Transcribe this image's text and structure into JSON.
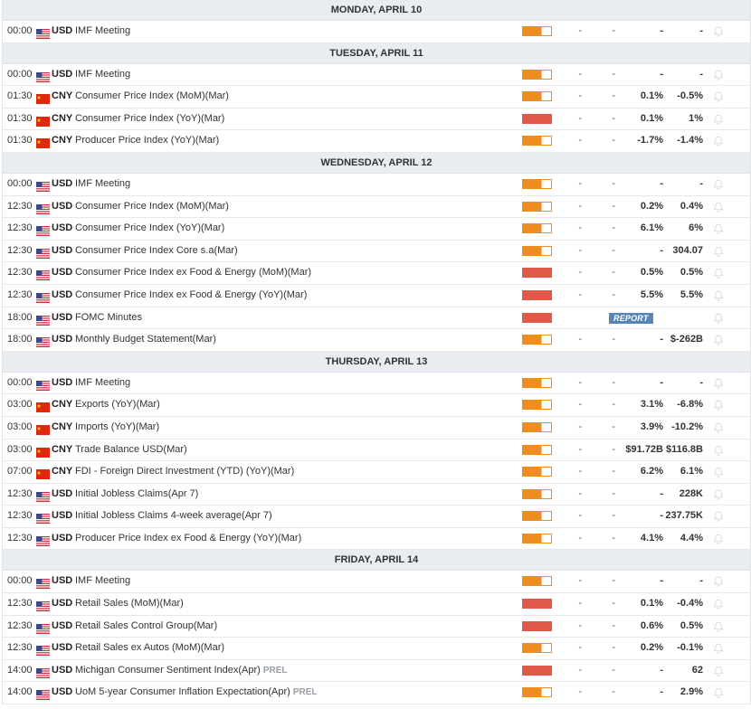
{
  "colors": {
    "impact_medium": "#ef8d21",
    "impact_high": "#e05949",
    "day_header_bg": "#e9ecf0",
    "report_badge_bg": "#5886b3"
  },
  "days": [
    {
      "label": "MONDAY, APRIL 10",
      "events": [
        {
          "time": "00:00",
          "flag": "us-flag",
          "currency": "USD",
          "name": "IMF Meeting",
          "prel": "",
          "impact": "medium",
          "actual": "-",
          "deviation": "-",
          "consensus": "-",
          "previous": "-",
          "report": ""
        }
      ]
    },
    {
      "label": "TUESDAY, APRIL 11",
      "events": [
        {
          "time": "00:00",
          "flag": "us-flag",
          "currency": "USD",
          "name": "IMF Meeting",
          "prel": "",
          "impact": "medium",
          "actual": "-",
          "deviation": "-",
          "consensus": "-",
          "previous": "-",
          "report": ""
        },
        {
          "time": "01:30",
          "flag": "cn-flag",
          "currency": "CNY",
          "name": "Consumer Price Index (MoM)(Mar)",
          "prel": "",
          "impact": "medium",
          "actual": "-",
          "deviation": "-",
          "consensus": "0.1%",
          "previous": "-0.5%",
          "report": ""
        },
        {
          "time": "01:30",
          "flag": "cn-flag",
          "currency": "CNY",
          "name": "Consumer Price Index (YoY)(Mar)",
          "prel": "",
          "impact": "high",
          "actual": "-",
          "deviation": "-",
          "consensus": "0.1%",
          "previous": "1%",
          "report": ""
        },
        {
          "time": "01:30",
          "flag": "cn-flag",
          "currency": "CNY",
          "name": "Producer Price Index (YoY)(Mar)",
          "prel": "",
          "impact": "medium",
          "actual": "-",
          "deviation": "-",
          "consensus": "-1.7%",
          "previous": "-1.4%",
          "report": ""
        }
      ]
    },
    {
      "label": "WEDNESDAY, APRIL 12",
      "events": [
        {
          "time": "00:00",
          "flag": "us-flag",
          "currency": "USD",
          "name": "IMF Meeting",
          "prel": "",
          "impact": "medium",
          "actual": "-",
          "deviation": "-",
          "consensus": "-",
          "previous": "-",
          "report": ""
        },
        {
          "time": "12:30",
          "flag": "us-flag",
          "currency": "USD",
          "name": "Consumer Price Index (MoM)(Mar)",
          "prel": "",
          "impact": "medium",
          "actual": "-",
          "deviation": "-",
          "consensus": "0.2%",
          "previous": "0.4%",
          "report": ""
        },
        {
          "time": "12:30",
          "flag": "us-flag",
          "currency": "USD",
          "name": "Consumer Price Index (YoY)(Mar)",
          "prel": "",
          "impact": "medium",
          "actual": "-",
          "deviation": "-",
          "consensus": "6.1%",
          "previous": "6%",
          "report": ""
        },
        {
          "time": "12:30",
          "flag": "us-flag",
          "currency": "USD",
          "name": "Consumer Price Index Core s.a(Mar)",
          "prel": "",
          "impact": "medium",
          "actual": "-",
          "deviation": "-",
          "consensus": "-",
          "previous": "304.07",
          "report": ""
        },
        {
          "time": "12:30",
          "flag": "us-flag",
          "currency": "USD",
          "name": "Consumer Price Index ex Food & Energy (MoM)(Mar)",
          "prel": "",
          "impact": "high",
          "actual": "-",
          "deviation": "-",
          "consensus": "0.5%",
          "previous": "0.5%",
          "report": ""
        },
        {
          "time": "12:30",
          "flag": "us-flag",
          "currency": "USD",
          "name": "Consumer Price Index ex Food & Energy (YoY)(Mar)",
          "prel": "",
          "impact": "high",
          "actual": "-",
          "deviation": "-",
          "consensus": "5.5%",
          "previous": "5.5%",
          "report": ""
        },
        {
          "time": "18:00",
          "flag": "us-flag",
          "currency": "USD",
          "name": "FOMC Minutes",
          "prel": "",
          "impact": "high",
          "actual": "",
          "deviation": "",
          "consensus": "",
          "previous": "",
          "report": "REPORT"
        },
        {
          "time": "18:00",
          "flag": "us-flag",
          "currency": "USD",
          "name": "Monthly Budget Statement(Mar)",
          "prel": "",
          "impact": "medium",
          "actual": "-",
          "deviation": "-",
          "consensus": "-",
          "previous": "$-262B",
          "report": ""
        }
      ]
    },
    {
      "label": "THURSDAY, APRIL 13",
      "events": [
        {
          "time": "00:00",
          "flag": "us-flag",
          "currency": "USD",
          "name": "IMF Meeting",
          "prel": "",
          "impact": "medium",
          "actual": "-",
          "deviation": "-",
          "consensus": "-",
          "previous": "-",
          "report": ""
        },
        {
          "time": "03:00",
          "flag": "cn-flag",
          "currency": "CNY",
          "name": "Exports (YoY)(Mar)",
          "prel": "",
          "impact": "medium",
          "actual": "-",
          "deviation": "-",
          "consensus": "3.1%",
          "previous": "-6.8%",
          "report": ""
        },
        {
          "time": "03:00",
          "flag": "cn-flag",
          "currency": "CNY",
          "name": "Imports (YoY)(Mar)",
          "prel": "",
          "impact": "medium",
          "actual": "-",
          "deviation": "-",
          "consensus": "3.9%",
          "previous": "-10.2%",
          "report": ""
        },
        {
          "time": "03:00",
          "flag": "cn-flag",
          "currency": "CNY",
          "name": "Trade Balance USD(Mar)",
          "prel": "",
          "impact": "medium",
          "actual": "-",
          "deviation": "-",
          "consensus": "$91.72B",
          "previous": "$116.8B",
          "report": ""
        },
        {
          "time": "07:00",
          "flag": "cn-flag",
          "currency": "CNY",
          "name": "FDI - Foreign Direct Investment (YTD) (YoY)(Mar)",
          "prel": "",
          "impact": "medium",
          "actual": "-",
          "deviation": "-",
          "consensus": "6.2%",
          "previous": "6.1%",
          "report": ""
        },
        {
          "time": "12:30",
          "flag": "us-flag",
          "currency": "USD",
          "name": "Initial Jobless Claims(Apr 7)",
          "prel": "",
          "impact": "medium",
          "actual": "-",
          "deviation": "-",
          "consensus": "-",
          "previous": "228K",
          "report": ""
        },
        {
          "time": "12:30",
          "flag": "us-flag",
          "currency": "USD",
          "name": "Initial Jobless Claims 4-week average(Apr 7)",
          "prel": "",
          "impact": "medium",
          "actual": "-",
          "deviation": "-",
          "consensus": "-",
          "previous": "237.75K",
          "report": ""
        },
        {
          "time": "12:30",
          "flag": "us-flag",
          "currency": "USD",
          "name": "Producer Price Index ex Food & Energy (YoY)(Mar)",
          "prel": "",
          "impact": "medium",
          "actual": "-",
          "deviation": "-",
          "consensus": "4.1%",
          "previous": "4.4%",
          "report": ""
        }
      ]
    },
    {
      "label": "FRIDAY, APRIL 14",
      "events": [
        {
          "time": "00:00",
          "flag": "us-flag",
          "currency": "USD",
          "name": "IMF Meeting",
          "prel": "",
          "impact": "medium",
          "actual": "-",
          "deviation": "-",
          "consensus": "-",
          "previous": "-",
          "report": ""
        },
        {
          "time": "12:30",
          "flag": "us-flag",
          "currency": "USD",
          "name": "Retail Sales (MoM)(Mar)",
          "prel": "",
          "impact": "high",
          "actual": "-",
          "deviation": "-",
          "consensus": "0.1%",
          "previous": "-0.4%",
          "report": ""
        },
        {
          "time": "12:30",
          "flag": "us-flag",
          "currency": "USD",
          "name": "Retail Sales Control Group(Mar)",
          "prel": "",
          "impact": "high",
          "actual": "-",
          "deviation": "-",
          "consensus": "0.6%",
          "previous": "0.5%",
          "report": ""
        },
        {
          "time": "12:30",
          "flag": "us-flag",
          "currency": "USD",
          "name": "Retail Sales ex Autos (MoM)(Mar)",
          "prel": "",
          "impact": "medium",
          "actual": "-",
          "deviation": "-",
          "consensus": "0.2%",
          "previous": "-0.1%",
          "report": ""
        },
        {
          "time": "14:00",
          "flag": "us-flag",
          "currency": "USD",
          "name": "Michigan Consumer Sentiment Index(Apr)",
          "prel": "PREL",
          "impact": "high",
          "actual": "-",
          "deviation": "-",
          "consensus": "-",
          "previous": "62",
          "report": ""
        },
        {
          "time": "14:00",
          "flag": "us-flag",
          "currency": "USD",
          "name": "UoM 5-year Consumer Inflation Expectation(Apr)",
          "prel": "PREL",
          "impact": "medium",
          "actual": "-",
          "deviation": "-",
          "consensus": "-",
          "previous": "2.9%",
          "report": ""
        }
      ]
    }
  ]
}
